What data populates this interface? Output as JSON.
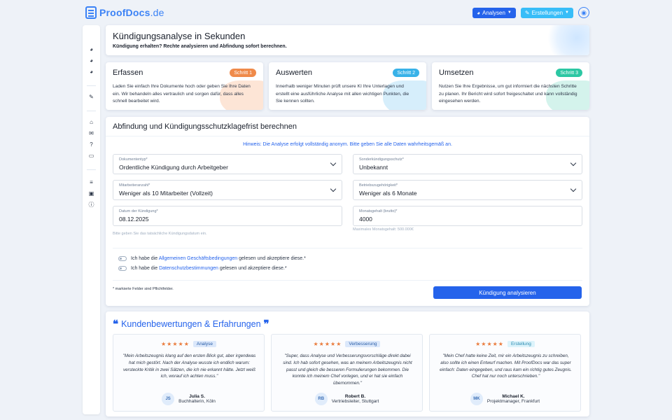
{
  "brand": {
    "name_main": "ProofDocs",
    "name_tld": ".de"
  },
  "topnav": {
    "analysen": "Analysen",
    "erstellungen": "Erstellungen"
  },
  "sidebar": {
    "icons": [
      "chart-pie-icon",
      "chart-pie-icon",
      "chart-pie-icon",
      "file-edit-icon",
      "home-icon",
      "comments-icon",
      "question-icon",
      "id-card-icon",
      "database-icon",
      "lock-icon",
      "info-icon"
    ]
  },
  "hero": {
    "title": "Kündigungsanalyse in Sekunden",
    "subtitle": "Kündigung erhalten? Rechte analysieren und Abfindung sofort berechnen."
  },
  "steps": [
    {
      "title": "Erfassen",
      "badge": "Schritt 1",
      "color": "#ef8a4a",
      "text": "Laden Sie einfach Ihre Dokumente hoch oder geben Sie Ihre Daten ein. Wir behandeln alles vertraulich und sorgen dafür, dass alles schnell bearbeitet wird."
    },
    {
      "title": "Auswerten",
      "badge": "Schritt 2",
      "color": "#38b2e8",
      "text": "Innerhalb weniger Minuten prüft unsere KI Ihre Unterlagen und erstellt eine ausführliche Analyse mit allen wichtigen Punkten, die Sie kennen sollten."
    },
    {
      "title": "Umsetzen",
      "badge": "Schritt 3",
      "color": "#2cc7a3",
      "text": "Nutzen Sie Ihre Ergebnisse, um gut informiert die nächsten Schritte zu planen. Ihr Bericht wird sofort freigeschaltet und kann vollständig eingesehen werden."
    }
  ],
  "form": {
    "title": "Abfindung und Kündigungsschutzklagefrist berechnen",
    "hint": "Hinweis: Die Analyse erfolgt vollständig anonym. Bitte geben Sie alle Daten wahrheitsgemäß an.",
    "fields": {
      "dokumententyp": {
        "label": "Dokumententyp*",
        "value": "Ordentliche Kündigung durch Arbeitgeber"
      },
      "sonderschutz": {
        "label": "Sonderkündigungsschutz*",
        "value": "Unbekannt"
      },
      "mitarbeiter": {
        "label": "Mitarbeiteranzahl*",
        "value": "Weniger als 10 Mitarbeiter (Vollzeit)"
      },
      "betrieb": {
        "label": "Betriebszugehörigkeit*",
        "value": "Weniger als 6 Monate"
      },
      "datum": {
        "label": "Datum der Kündigung*",
        "value": "08.12.2025",
        "help": "Bitte geben Sie das tatsächliche Kündigungsdatum ein."
      },
      "gehalt": {
        "label": "Monatsgehalt (brutto)*",
        "value": "4000",
        "help": "Maximales Monatsgehalt: 500.000€"
      }
    },
    "agb": {
      "pre": "Ich habe die ",
      "link": "Allgemeinen Geschäftsbedingungen",
      "post": " gelesen und akzeptiere diese.*"
    },
    "privacy": {
      "pre": "Ich habe die ",
      "link": "Datenschutzbestimmungen",
      "post": " gelesen und akzeptiere diese.*"
    },
    "required_note": "* markierte Felder sind Pflichtfelder.",
    "submit": "Kündigung analysieren"
  },
  "reviews": {
    "title": "Kundenbewertungen & Erfahrungen",
    "stars": "★★★★★",
    "items": [
      {
        "tag": "Analyse",
        "tag_bg": "#dbe8fb",
        "tag_color": "#2b5ea7",
        "text": "\"Mein Arbeitszeugnis klang auf den ersten Blick gut, aber irgendwas hat mich gestört. Nach der Analyse wusste ich endlich warum: versteckte Kritik in zwei Sätzen, die ich nie erkannt hätte. Jetzt weiß ich, worauf ich achten muss.\"",
        "initials": "JS",
        "name": "Julia S.",
        "role": "Buchhalterin, Köln"
      },
      {
        "tag": "Verbesserung",
        "tag_bg": "#dbe8fb",
        "tag_color": "#2b5ea7",
        "text": "\"Super, dass Analyse und Verbesserungsvorschläge direkt dabei sind. Ich hab sofort gesehen, was an meinem Arbeitszeugnis nicht passt und gleich die besseren Formulierungen bekommen. Die konnte ich meinem Chef vorlegen, und er hat sie einfach übernommen.\"",
        "initials": "RB",
        "name": "Robert B.",
        "role": "Vertriebsleiter, Stuttgart"
      },
      {
        "tag": "Erstellung",
        "tag_bg": "#dcf3fb",
        "tag_color": "#2a8bb0",
        "text": "\"Mein Chef hatte keine Zeit, mir ein Arbeitszeugnis zu schreiben, also sollte ich einen Entwurf machen. Mit ProofDocs war das super einfach: Daten eingegeben, und raus kam ein richtig gutes Zeugnis. Chef hat nur noch unterschrieben.\"",
        "initials": "MK",
        "name": "Michael K.",
        "role": "Projektmanager, Frankfurt"
      }
    ]
  }
}
